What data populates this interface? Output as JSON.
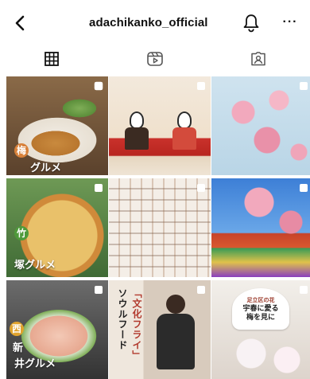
{
  "header": {
    "username": "adachikanko_official",
    "back_icon": "chevron-left-icon",
    "bell_icon": "bell-icon",
    "more_label": "···"
  },
  "tabs": [
    {
      "icon": "grid-icon",
      "active": true
    },
    {
      "icon": "reels-icon",
      "active": false
    },
    {
      "icon": "tagged-icon",
      "active": false
    }
  ],
  "posts": [
    {
      "badge": "梅",
      "caption": "グルメ",
      "badge_color": "#d8813a"
    },
    {},
    {},
    {
      "badge": "竹",
      "caption": "塚グルメ",
      "badge_color": "#4e9a3a"
    },
    {},
    {},
    {
      "badge": "西",
      "caption_line1": "新",
      "caption_line2": "井グルメ",
      "badge_color": "#e0a32e"
    },
    {
      "vertical_text_a": "ソウルフード",
      "vertical_text_b": "「文化フライ」"
    },
    {
      "top_small": "足立区の花",
      "top_main_1": "宇春に愛る",
      "top_main_2": "梅を見に"
    }
  ],
  "colors": {
    "text": "#111111",
    "icon": "#111111",
    "overlay_text": "#ffffff"
  }
}
